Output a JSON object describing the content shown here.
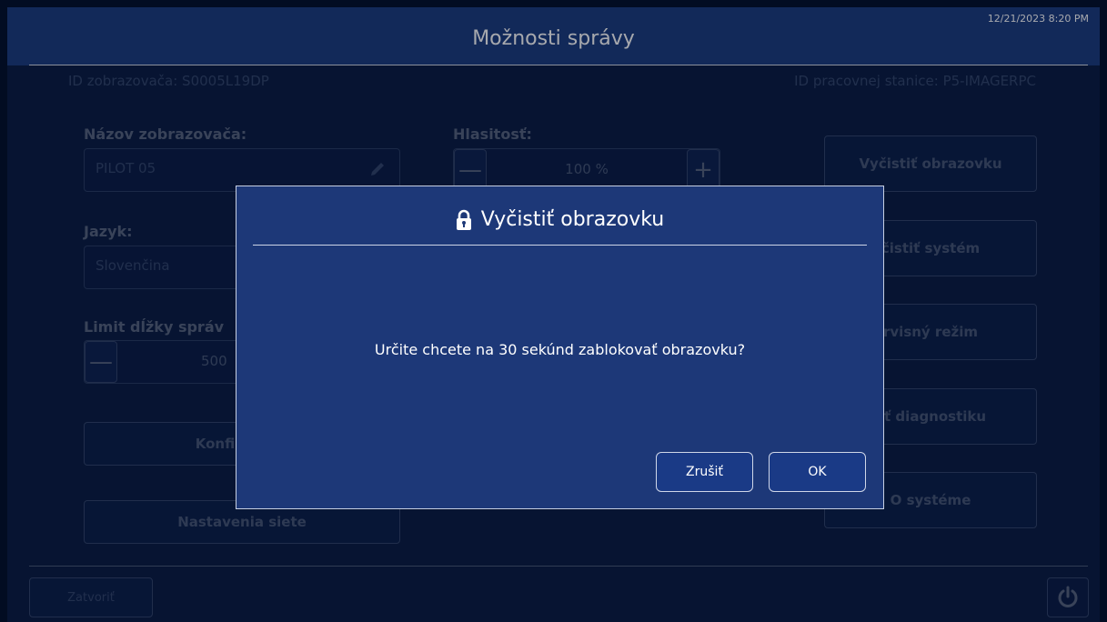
{
  "header": {
    "title": "Možnosti správy",
    "datetime": "12/21/2023 8:20 PM"
  },
  "info": {
    "display_id": "ID zobrazovača: S0005L19DP",
    "workstation_id": "ID pracovnej stanice: P5-IMAGERPC"
  },
  "form": {
    "display_name_label": "Názov zobrazovača:",
    "display_name_value": "PILOT 05",
    "volume_label": "Hlasitosť:",
    "volume_value": "100 %",
    "language_label": "Jazyk:",
    "language_value": "Slovenčina",
    "message_limit_label": "Limit dĺžky správ",
    "message_limit_value": "500",
    "minus_symbol": "—",
    "plus_symbol": "+"
  },
  "buttons": {
    "configure": "Konfigurova",
    "network": "Nastavenia siete",
    "clear_screen": "Vyčistiť obrazovku",
    "clear_system": "čistiť systém",
    "service_mode": "rvisný režim",
    "diagnostics": "ať diagnostiku",
    "about_system": "O systéme",
    "close": "Zatvoriť"
  },
  "dialog": {
    "title": "Vyčistiť obrazovku",
    "message": "Určite chcete na 30 sekúnd zablokovať obrazovku?",
    "cancel_label": "Zrušiť",
    "ok_label": "OK",
    "title_icon": "lock-icon"
  },
  "colors": {
    "header_bg": "#1d3c7e",
    "page_bg": "#0b1d42",
    "dialog_bg": "#1d3878"
  }
}
